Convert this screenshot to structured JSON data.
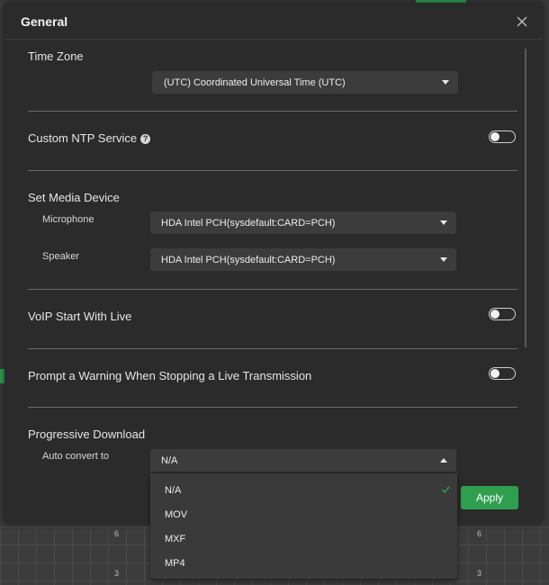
{
  "dialog": {
    "title": "General"
  },
  "time_zone": {
    "section_title": "Time Zone",
    "selected": "(UTC) Coordinated Universal Time (UTC)"
  },
  "ntp": {
    "label": "Custom NTP Service",
    "help_glyph": "?",
    "enabled": false
  },
  "media_device": {
    "section_title": "Set Media Device",
    "microphone_label": "Microphone",
    "microphone_value": "HDA Intel PCH(sysdefault:CARD=PCH)",
    "speaker_label": "Speaker",
    "speaker_value": "HDA Intel PCH(sysdefault:CARD=PCH)"
  },
  "voip": {
    "label": "VoIP Start With Live",
    "enabled": false
  },
  "prompt_warning": {
    "label": "Prompt a Warning When Stopping a Live Transmission",
    "enabled": false
  },
  "progressive_download": {
    "section_title": "Progressive Download",
    "auto_convert_label": "Auto convert to",
    "selected": "N/A",
    "options": [
      "N/A",
      "MOV",
      "MXF",
      "MP4"
    ]
  },
  "footer": {
    "apply_label": "Apply"
  },
  "background": {
    "tick_labels": [
      "6",
      "3",
      "6",
      "3"
    ]
  },
  "colors": {
    "accent_green": "#2f9e4f",
    "dialog_bg": "#2b2b2b"
  }
}
